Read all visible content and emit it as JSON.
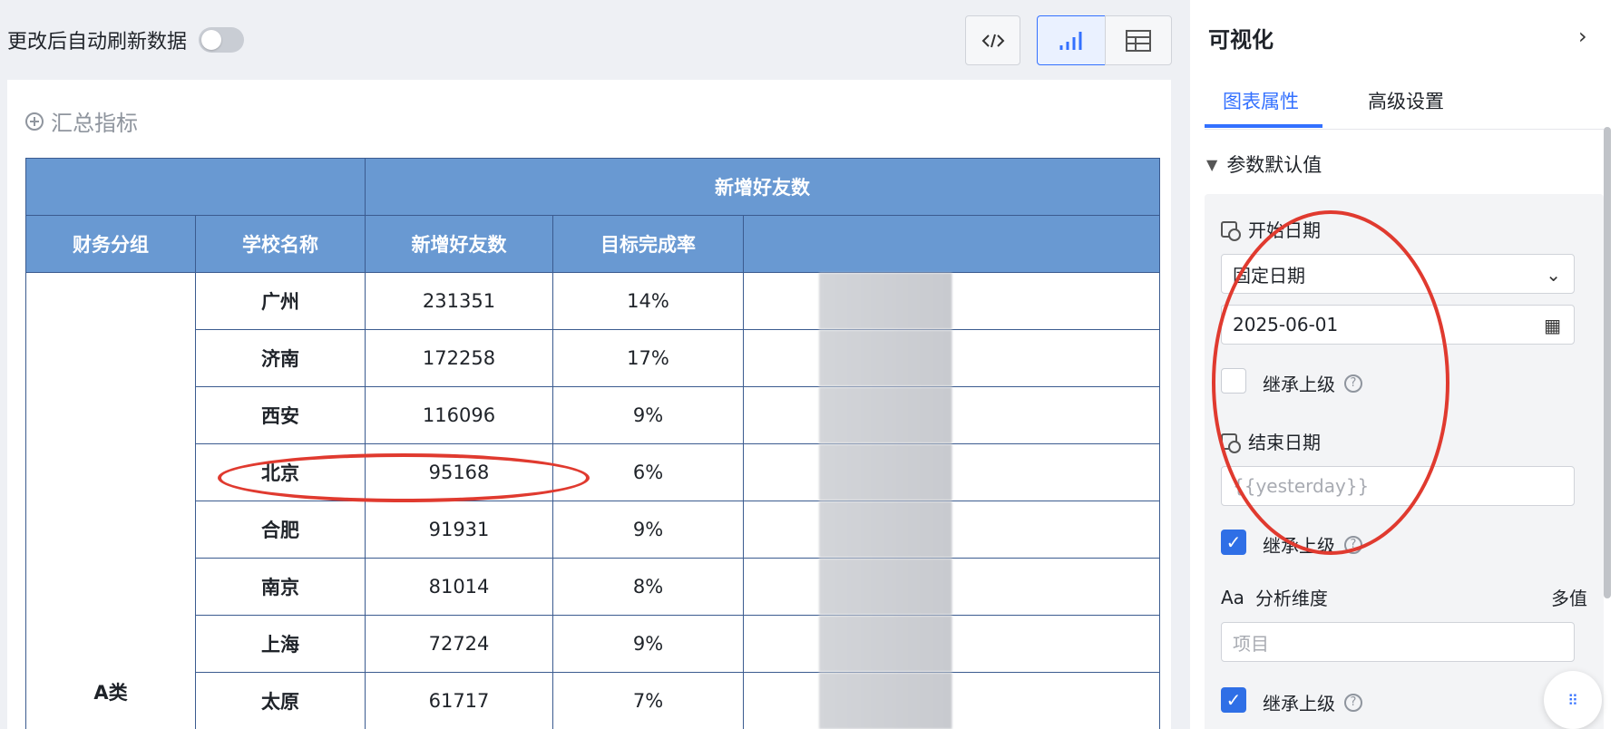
{
  "toolbar": {
    "auto_refresh_label": "更改后自动刷新数据",
    "auto_refresh_on": false,
    "code_icon": "code-icon",
    "chart_icon": "bar-chart-icon",
    "table_icon": "table-icon"
  },
  "main": {
    "summary_label": "汇总指标",
    "group_header": "新增好友数",
    "columns": [
      "财务分组",
      "学校名称",
      "新增好友数",
      "目标完成率"
    ],
    "group": "A类",
    "rows": [
      {
        "school": "广州",
        "friends": "231351",
        "rate": "14%"
      },
      {
        "school": "济南",
        "friends": "172258",
        "rate": "17%"
      },
      {
        "school": "西安",
        "friends": "116096",
        "rate": "9%"
      },
      {
        "school": "北京",
        "friends": "95168",
        "rate": "6%"
      },
      {
        "school": "合肥",
        "friends": "91931",
        "rate": "9%"
      },
      {
        "school": "南京",
        "friends": "81014",
        "rate": "8%"
      },
      {
        "school": "上海",
        "friends": "72724",
        "rate": "9%"
      },
      {
        "school": "太原",
        "friends": "61717",
        "rate": "7%"
      }
    ]
  },
  "side": {
    "title": "可视化",
    "tabs": [
      "图表属性",
      "高级设置"
    ],
    "active_tab": "图表属性",
    "section": "参数默认值",
    "start_date_label": "开始日期",
    "start_mode": "固定日期",
    "start_value": "2025-06-01",
    "inherit_label": "继承上级",
    "end_date_label": "结束日期",
    "end_placeholder": "{{yesterday}}",
    "dimension_label": "分析维度",
    "dimension_mode": "多值",
    "dimension_placeholder": "项目",
    "checks": [
      false,
      true,
      true
    ]
  },
  "colors": {
    "header_bg": "#6999d2",
    "accent": "#3370ff",
    "annotation": "#e03a2f"
  }
}
